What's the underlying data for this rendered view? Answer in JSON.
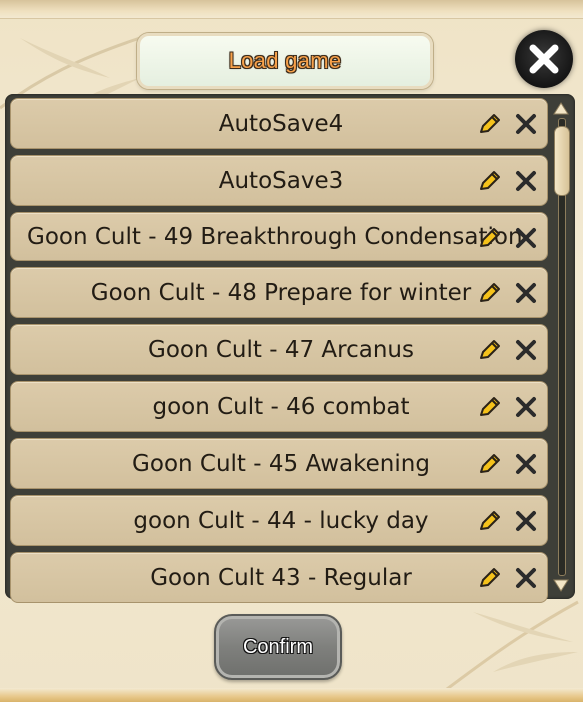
{
  "dialog": {
    "title": "Load game",
    "confirm_label": "Confirm"
  },
  "saves": [
    {
      "name": "AutoSave4"
    },
    {
      "name": "AutoSave3"
    },
    {
      "name": "Goon Cult - 49 Breakthrough Condensation"
    },
    {
      "name": "Goon Cult - 48 Prepare for winter"
    },
    {
      "name": "Goon Cult - 47 Arcanus"
    },
    {
      "name": "goon Cult - 46 combat"
    },
    {
      "name": "Goon Cult - 45 Awakening"
    },
    {
      "name": "goon Cult - 44 - lucky day"
    },
    {
      "name": "Goon Cult 43 - Regular"
    }
  ],
  "icons": {
    "rename": "pencil-icon",
    "delete": "x-icon",
    "close": "close-icon"
  },
  "colors": {
    "title_text": "#f7a14a",
    "pencil": "#f5c21b",
    "row_bg": "#d6c4a1",
    "panel_bg": "#3e3f38"
  }
}
